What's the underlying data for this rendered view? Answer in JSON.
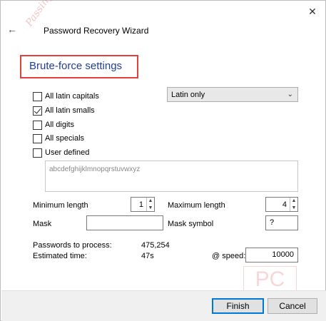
{
  "window": {
    "title": "Password Recovery Wizard",
    "close_glyph": "✕",
    "back_glyph": "←"
  },
  "section": {
    "title": "Brute-force settings"
  },
  "charsets": {
    "all_latin_capitals": {
      "label": "All latin capitals",
      "checked": false
    },
    "all_latin_smalls": {
      "label": "All latin smalls",
      "checked": true
    },
    "all_digits": {
      "label": "All digits",
      "checked": false
    },
    "all_specials": {
      "label": "All specials",
      "checked": false
    },
    "user_defined": {
      "label": "User defined",
      "checked": false
    }
  },
  "language_select": {
    "value": "Latin only",
    "chevron": "⌄"
  },
  "charset_preview": "abcdefghijklmnopqrstuvwxyz",
  "length": {
    "min_label": "Minimum length",
    "min_value": "1",
    "max_label": "Maximum length",
    "max_value": "4"
  },
  "mask": {
    "label": "Mask",
    "value": "",
    "symbol_label": "Mask symbol",
    "symbol_value": "?"
  },
  "stats": {
    "passwords_label": "Passwords to process:",
    "passwords_value": "475,254",
    "time_label": "Estimated time:",
    "time_value": "47s",
    "speed_label": "@ speed:",
    "speed_value": "10000"
  },
  "buttons": {
    "finish": "Finish",
    "cancel": "Cancel"
  },
  "watermarks": {
    "side_text": "PassingPC",
    "logo_text": "PC"
  }
}
